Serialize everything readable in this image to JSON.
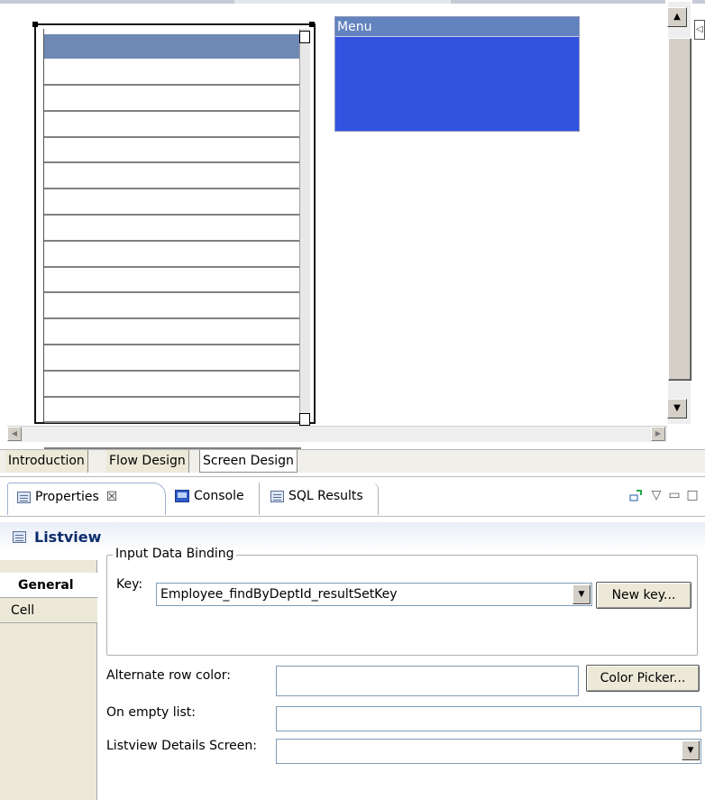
{
  "designer": {
    "menu_widget": {
      "title": "Menu"
    },
    "listview_row_count": 15
  },
  "editor_tabs": [
    {
      "label": "Introduction",
      "active": false
    },
    {
      "label": "Flow Design",
      "active": false
    },
    {
      "label": "Screen Design",
      "active": true
    }
  ],
  "view_tabs": [
    {
      "label": "Properties",
      "icon": "properties-icon",
      "active": true,
      "close_glyph": "☒"
    },
    {
      "label": "Console",
      "icon": "console-icon",
      "active": false
    },
    {
      "label": "SQL Results",
      "icon": "sql-results-icon",
      "active": false
    }
  ],
  "properties": {
    "header_title": "Listview",
    "side_tabs": [
      {
        "label": "General",
        "selected": true
      },
      {
        "label": "Cell",
        "selected": false
      }
    ],
    "input_binding": {
      "group_label": "Input Data Binding",
      "key_label": "Key:",
      "key_value": "Employee_findByDeptId_resultSetKey",
      "new_key_button": "New key..."
    },
    "alternate_row_color": {
      "label": "Alternate row color:",
      "value": "",
      "button": "Color Picker..."
    },
    "on_empty_list": {
      "label": "On empty list:",
      "value": ""
    },
    "details_screen": {
      "label": "Listview Details Screen:",
      "value": ""
    }
  },
  "colors": {
    "menu_body": "#3252e0",
    "menu_title": "#6383bf",
    "listview_header": "#6f89b5",
    "header_title_text": "#0c2d6b"
  }
}
